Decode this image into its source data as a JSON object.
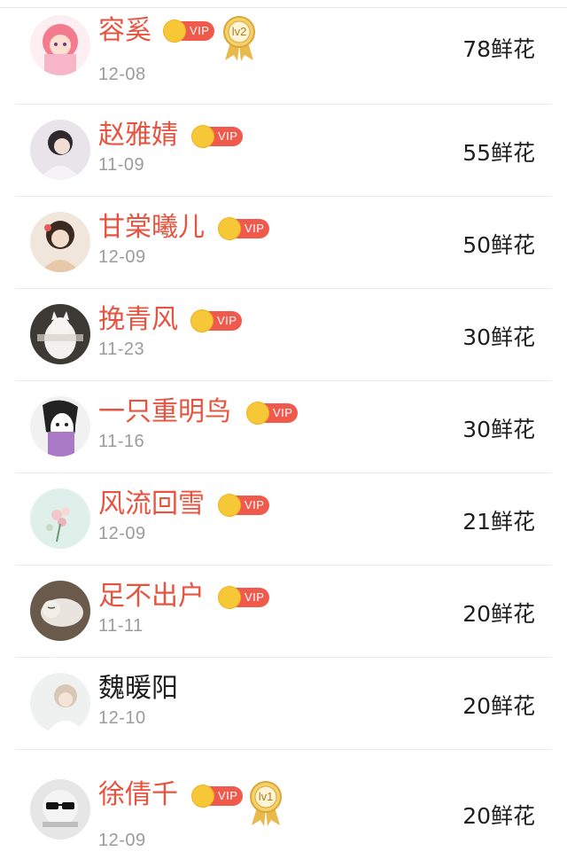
{
  "vip_badge_text": "VIP",
  "colors": {
    "vip_name": "#e8533f",
    "vip_badge": "#ef5a4d",
    "crown": "#f6c737",
    "date": "#9b9b9b",
    "divider": "#ececec"
  },
  "rows": [
    {
      "name": "容奚",
      "vip": true,
      "level": "lv2",
      "date": "12-08",
      "flowers": "78鲜花",
      "avatar_icon": "anime-girl-avatar"
    },
    {
      "name": "赵雅婧",
      "vip": true,
      "level": "",
      "date": "11-09",
      "flowers": "55鲜花",
      "avatar_icon": "woman-portrait-avatar"
    },
    {
      "name": "甘棠曦儿",
      "vip": true,
      "level": "",
      "date": "12-09",
      "flowers": "50鲜花",
      "avatar_icon": "traditional-girl-avatar"
    },
    {
      "name": "挽青风",
      "vip": true,
      "level": "",
      "date": "11-23",
      "flowers": "30鲜花",
      "avatar_icon": "cat-avatar"
    },
    {
      "name": "一只重明鸟",
      "vip": true,
      "level": "",
      "date": "11-16",
      "flowers": "30鲜花",
      "avatar_icon": "cartoon-face-avatar"
    },
    {
      "name": "风流回雪",
      "vip": true,
      "level": "",
      "date": "12-09",
      "flowers": "21鲜花",
      "avatar_icon": "flower-avatar"
    },
    {
      "name": "足不出户",
      "vip": true,
      "level": "",
      "date": "11-11",
      "flowers": "20鲜花",
      "avatar_icon": "sleeping-cat-avatar"
    },
    {
      "name": "魏暖阳",
      "vip": false,
      "level": "",
      "date": "12-10",
      "flowers": "20鲜花",
      "avatar_icon": "girl-avatar"
    },
    {
      "name": "徐倩千",
      "vip": true,
      "level": "lv1",
      "date": "12-09",
      "flowers": "20鲜花",
      "avatar_icon": "sunglasses-face-avatar"
    }
  ]
}
